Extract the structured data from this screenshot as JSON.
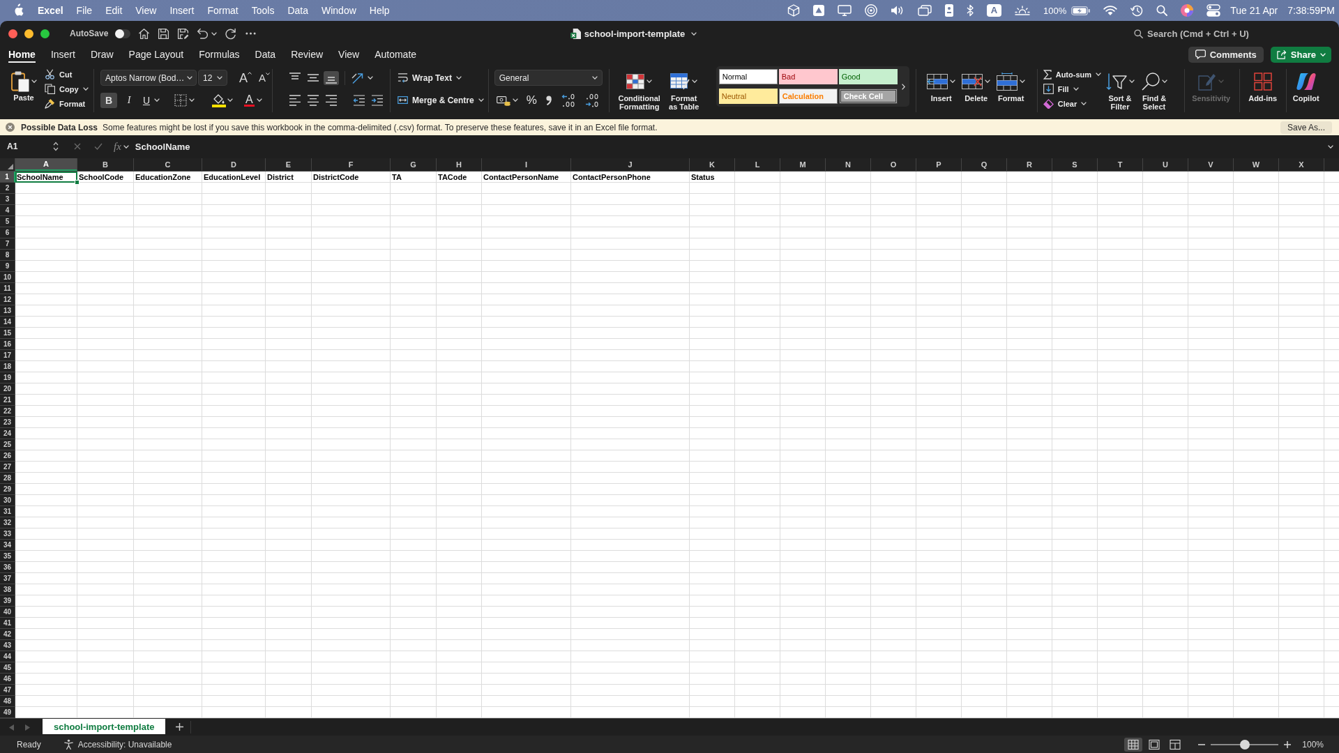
{
  "menu_bar": {
    "app_name": "Excel",
    "menus": [
      "File",
      "Edit",
      "View",
      "Insert",
      "Format",
      "Tools",
      "Data",
      "Window",
      "Help"
    ],
    "input_source": "A",
    "battery": "100%",
    "date": "Tue 21 Apr",
    "time": "7:38:59PM"
  },
  "title_bar": {
    "autosave": {
      "label": "AutoSave",
      "on": false
    },
    "document": "school-import-template",
    "search": {
      "placeholder": "Search (Cmd + Ctrl + U)"
    }
  },
  "ribbon_tabs": [
    {
      "label": "Home",
      "selected": true
    },
    {
      "label": "Insert",
      "selected": false
    },
    {
      "label": "Draw",
      "selected": false
    },
    {
      "label": "Page Layout",
      "selected": false
    },
    {
      "label": "Formulas",
      "selected": false
    },
    {
      "label": "Data",
      "selected": false
    },
    {
      "label": "Review",
      "selected": false
    },
    {
      "label": "View",
      "selected": false
    },
    {
      "label": "Automate",
      "selected": false
    }
  ],
  "comments_button": "Comments",
  "share_button": "Share",
  "ribbon": {
    "clipboard": {
      "paste": "Paste",
      "cut": "Cut",
      "copy": "Copy",
      "format_painter": "Format"
    },
    "font": {
      "name": "Aptos Narrow (Bod…",
      "size": "12",
      "grow": "A",
      "shrink": "A",
      "styles": [
        {
          "label": "B",
          "selected": true
        },
        {
          "label": "I",
          "selected": false
        },
        {
          "label": "U",
          "selected": false
        }
      ],
      "font_color": "A"
    },
    "alignment": {
      "vertical": [
        {
          "selected": false
        },
        {
          "selected": false
        },
        {
          "selected": true
        }
      ],
      "horizontal": [
        {
          "selected": false
        },
        {
          "selected": false
        },
        {
          "selected": false
        }
      ],
      "wrap_text": "Wrap Text",
      "merge": "Merge & Centre"
    },
    "number": {
      "format": "General",
      "percent": "%"
    },
    "conditional_formatting": "Conditional Formatting",
    "format_as_table": "Format as Table",
    "styles": [
      {
        "label": "Normal",
        "kind": "normal"
      },
      {
        "label": "Bad",
        "kind": "bad"
      },
      {
        "label": "Good",
        "kind": "good"
      },
      {
        "label": "Neutral",
        "kind": "neutral"
      },
      {
        "label": "Calculation",
        "kind": "calculation"
      },
      {
        "label": "Check Cell",
        "kind": "check"
      }
    ],
    "cells": [
      "Insert",
      "Delete",
      "Format"
    ],
    "editing": {
      "autosum": "Auto-sum",
      "fill": "Fill",
      "clear": "Clear",
      "sort_filter": "Sort & Filter",
      "find_select": "Find & Select"
    },
    "sensitivity": {
      "label": "Sensitivity",
      "disabled": true
    },
    "add_ins": "Add-ins",
    "copilot": "Copilot"
  },
  "notification": {
    "title": "Possible Data Loss",
    "message": "Some features might be lost if you save this workbook in the comma-delimited (.csv) format. To preserve these features, save it in an Excel file format.",
    "button": "Save As..."
  },
  "formula_bar": {
    "name_box": "A1",
    "function_label": "fx",
    "value": "SchoolName"
  },
  "sheet": {
    "columns": [
      {
        "label": "A",
        "selected": true
      },
      {
        "label": "B",
        "selected": false
      },
      {
        "label": "C",
        "selected": false
      },
      {
        "label": "D",
        "selected": false
      },
      {
        "label": "E",
        "selected": false
      },
      {
        "label": "F",
        "selected": false
      },
      {
        "label": "G",
        "selected": false
      },
      {
        "label": "H",
        "selected": false
      },
      {
        "label": "I",
        "selected": false
      },
      {
        "label": "J",
        "selected": false
      },
      {
        "label": "K",
        "selected": false
      },
      {
        "label": "L",
        "selected": false
      },
      {
        "label": "M",
        "selected": false
      },
      {
        "label": "N",
        "selected": false
      },
      {
        "label": "O",
        "selected": false
      },
      {
        "label": "P",
        "selected": false
      },
      {
        "label": "Q",
        "selected": false
      },
      {
        "label": "R",
        "selected": false
      },
      {
        "label": "S",
        "selected": false
      },
      {
        "label": "T",
        "selected": false
      },
      {
        "label": "U",
        "selected": false
      },
      {
        "label": "V",
        "selected": false
      },
      {
        "label": "W",
        "selected": false
      },
      {
        "label": "X",
        "selected": false
      }
    ],
    "rows": [
      {
        "number": "1",
        "selected": true,
        "cells": [
          "SchoolName",
          "SchoolCode",
          "EducationZone",
          "EducationLevel",
          "District",
          "DistrictCode",
          "TA",
          "TACode",
          "ContactPersonName",
          "ContactPersonPhone",
          "Status"
        ]
      },
      {
        "number": "2",
        "selected": false
      },
      {
        "number": "3",
        "selected": false
      },
      {
        "number": "4",
        "selected": false
      },
      {
        "number": "5",
        "selected": false
      },
      {
        "number": "6",
        "selected": false
      },
      {
        "number": "7",
        "selected": false
      },
      {
        "number": "8",
        "selected": false
      },
      {
        "number": "9",
        "selected": false
      },
      {
        "number": "10",
        "selected": false
      },
      {
        "number": "11",
        "selected": false
      },
      {
        "number": "12",
        "selected": false
      },
      {
        "number": "13",
        "selected": false
      },
      {
        "number": "14",
        "selected": false
      },
      {
        "number": "15",
        "selected": false
      },
      {
        "number": "16",
        "selected": false
      },
      {
        "number": "17",
        "selected": false
      },
      {
        "number": "18",
        "selected": false
      },
      {
        "number": "19",
        "selected": false
      },
      {
        "number": "20",
        "selected": false
      },
      {
        "number": "21",
        "selected": false
      },
      {
        "number": "22",
        "selected": false
      },
      {
        "number": "23",
        "selected": false
      },
      {
        "number": "24",
        "selected": false
      },
      {
        "number": "25",
        "selected": false
      },
      {
        "number": "26",
        "selected": false
      },
      {
        "number": "27",
        "selected": false
      },
      {
        "number": "28",
        "selected": false
      },
      {
        "number": "29",
        "selected": false
      },
      {
        "number": "30",
        "selected": false
      },
      {
        "number": "31",
        "selected": false
      },
      {
        "number": "32",
        "selected": false
      },
      {
        "number": "33",
        "selected": false
      },
      {
        "number": "34",
        "selected": false
      },
      {
        "number": "35",
        "selected": false
      },
      {
        "number": "36",
        "selected": false
      },
      {
        "number": "37",
        "selected": false
      },
      {
        "number": "38",
        "selected": false
      },
      {
        "number": "39",
        "selected": false
      },
      {
        "number": "40",
        "selected": false
      },
      {
        "number": "41",
        "selected": false
      },
      {
        "number": "42",
        "selected": false
      },
      {
        "number": "43",
        "selected": false
      },
      {
        "number": "44",
        "selected": false
      },
      {
        "number": "45",
        "selected": false
      },
      {
        "number": "46",
        "selected": false
      },
      {
        "number": "47",
        "selected": false
      },
      {
        "number": "48",
        "selected": false
      },
      {
        "number": "49",
        "selected": false
      }
    ]
  },
  "sheet_tabs": [
    {
      "label": "school-import-template",
      "selected": true
    }
  ],
  "status_bar": {
    "mode": "Ready",
    "accessibility": "Accessibility: Unavailable",
    "views": [
      {
        "selected": true
      },
      {
        "selected": false
      },
      {
        "selected": false
      }
    ],
    "zoom": {
      "level": 0.5,
      "label": "100%"
    }
  }
}
